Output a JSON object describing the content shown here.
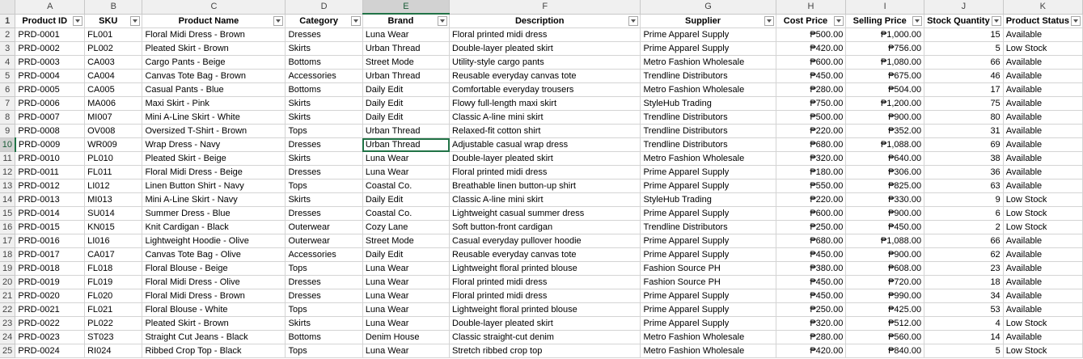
{
  "columns": [
    "A",
    "B",
    "C",
    "D",
    "E",
    "F",
    "G",
    "H",
    "I",
    "J",
    "K"
  ],
  "headers": [
    "Product ID",
    "SKU",
    "Product Name",
    "Category",
    "Brand",
    "Description",
    "Supplier",
    "Cost Price",
    "Selling Price",
    "Stock Quantity",
    "Product Status"
  ],
  "active_cell": {
    "column": "E",
    "row": 10
  },
  "rows": [
    [
      "PRD-0001",
      "FL001",
      "Floral Midi Dress - Brown",
      "Dresses",
      "Luna Wear",
      "Floral printed midi dress",
      "Prime Apparel Supply",
      "₱500.00",
      "₱1,000.00",
      "15",
      "Available"
    ],
    [
      "PRD-0002",
      "PL002",
      "Pleated Skirt - Brown",
      "Skirts",
      "Urban Thread",
      "Double-layer pleated skirt",
      "Prime Apparel Supply",
      "₱420.00",
      "₱756.00",
      "5",
      "Low Stock"
    ],
    [
      "PRD-0003",
      "CA003",
      "Cargo Pants - Beige",
      "Bottoms",
      "Street Mode",
      "Utility-style cargo pants",
      "Metro Fashion Wholesale",
      "₱600.00",
      "₱1,080.00",
      "66",
      "Available"
    ],
    [
      "PRD-0004",
      "CA004",
      "Canvas Tote Bag - Brown",
      "Accessories",
      "Urban Thread",
      "Reusable everyday canvas tote",
      "Trendline Distributors",
      "₱450.00",
      "₱675.00",
      "46",
      "Available"
    ],
    [
      "PRD-0005",
      "CA005",
      "Casual Pants - Blue",
      "Bottoms",
      "Daily Edit",
      "Comfortable everyday trousers",
      "Metro Fashion Wholesale",
      "₱280.00",
      "₱504.00",
      "17",
      "Available"
    ],
    [
      "PRD-0006",
      "MA006",
      "Maxi Skirt - Pink",
      "Skirts",
      "Daily Edit",
      "Flowy full-length maxi skirt",
      "StyleHub Trading",
      "₱750.00",
      "₱1,200.00",
      "75",
      "Available"
    ],
    [
      "PRD-0007",
      "MI007",
      "Mini A-Line Skirt - White",
      "Skirts",
      "Daily Edit",
      "Classic A-line mini skirt",
      "Trendline Distributors",
      "₱500.00",
      "₱900.00",
      "80",
      "Available"
    ],
    [
      "PRD-0008",
      "OV008",
      "Oversized T-Shirt - Brown",
      "Tops",
      "Urban Thread",
      "Relaxed-fit cotton shirt",
      "Trendline Distributors",
      "₱220.00",
      "₱352.00",
      "31",
      "Available"
    ],
    [
      "PRD-0009",
      "WR009",
      "Wrap Dress - Navy",
      "Dresses",
      "Urban Thread",
      "Adjustable casual wrap dress",
      "Trendline Distributors",
      "₱680.00",
      "₱1,088.00",
      "69",
      "Available"
    ],
    [
      "PRD-0010",
      "PL010",
      "Pleated Skirt - Beige",
      "Skirts",
      "Luna Wear",
      "Double-layer pleated skirt",
      "Metro Fashion Wholesale",
      "₱320.00",
      "₱640.00",
      "38",
      "Available"
    ],
    [
      "PRD-0011",
      "FL011",
      "Floral Midi Dress - Beige",
      "Dresses",
      "Luna Wear",
      "Floral printed midi dress",
      "Prime Apparel Supply",
      "₱180.00",
      "₱306.00",
      "36",
      "Available"
    ],
    [
      "PRD-0012",
      "LI012",
      "Linen Button Shirt - Navy",
      "Tops",
      "Coastal Co.",
      "Breathable linen button-up shirt",
      "Prime Apparel Supply",
      "₱550.00",
      "₱825.00",
      "63",
      "Available"
    ],
    [
      "PRD-0013",
      "MI013",
      "Mini A-Line Skirt - Navy",
      "Skirts",
      "Daily Edit",
      "Classic A-line mini skirt",
      "StyleHub Trading",
      "₱220.00",
      "₱330.00",
      "9",
      "Low Stock"
    ],
    [
      "PRD-0014",
      "SU014",
      "Summer Dress - Blue",
      "Dresses",
      "Coastal Co.",
      "Lightweight casual summer dress",
      "Prime Apparel Supply",
      "₱600.00",
      "₱900.00",
      "6",
      "Low Stock"
    ],
    [
      "PRD-0015",
      "KN015",
      "Knit Cardigan - Black",
      "Outerwear",
      "Cozy Lane",
      "Soft button-front cardigan",
      "Trendline Distributors",
      "₱250.00",
      "₱450.00",
      "2",
      "Low Stock"
    ],
    [
      "PRD-0016",
      "LI016",
      "Lightweight Hoodie - Olive",
      "Outerwear",
      "Street Mode",
      "Casual everyday pullover hoodie",
      "Prime Apparel Supply",
      "₱680.00",
      "₱1,088.00",
      "66",
      "Available"
    ],
    [
      "PRD-0017",
      "CA017",
      "Canvas Tote Bag - Olive",
      "Accessories",
      "Daily Edit",
      "Reusable everyday canvas tote",
      "Prime Apparel Supply",
      "₱450.00",
      "₱900.00",
      "62",
      "Available"
    ],
    [
      "PRD-0018",
      "FL018",
      "Floral Blouse - Beige",
      "Tops",
      "Luna Wear",
      "Lightweight floral printed blouse",
      "Fashion Source PH",
      "₱380.00",
      "₱608.00",
      "23",
      "Available"
    ],
    [
      "PRD-0019",
      "FL019",
      "Floral Midi Dress - Olive",
      "Dresses",
      "Luna Wear",
      "Floral printed midi dress",
      "Fashion Source PH",
      "₱450.00",
      "₱720.00",
      "18",
      "Available"
    ],
    [
      "PRD-0020",
      "FL020",
      "Floral Midi Dress - Brown",
      "Dresses",
      "Luna Wear",
      "Floral printed midi dress",
      "Prime Apparel Supply",
      "₱450.00",
      "₱990.00",
      "34",
      "Available"
    ],
    [
      "PRD-0021",
      "FL021",
      "Floral Blouse - White",
      "Tops",
      "Luna Wear",
      "Lightweight floral printed blouse",
      "Prime Apparel Supply",
      "₱250.00",
      "₱425.00",
      "53",
      "Available"
    ],
    [
      "PRD-0022",
      "PL022",
      "Pleated Skirt - Brown",
      "Skirts",
      "Luna Wear",
      "Double-layer pleated skirt",
      "Prime Apparel Supply",
      "₱320.00",
      "₱512.00",
      "4",
      "Low Stock"
    ],
    [
      "PRD-0023",
      "ST023",
      "Straight Cut Jeans - Black",
      "Bottoms",
      "Denim House",
      "Classic straight-cut denim",
      "Metro Fashion Wholesale",
      "₱280.00",
      "₱560.00",
      "14",
      "Available"
    ],
    [
      "PRD-0024",
      "RI024",
      "Ribbed Crop Top - Black",
      "Tops",
      "Luna Wear",
      "Stretch ribbed crop top",
      "Metro Fashion Wholesale",
      "₱420.00",
      "₱840.00",
      "5",
      "Low Stock"
    ]
  ]
}
